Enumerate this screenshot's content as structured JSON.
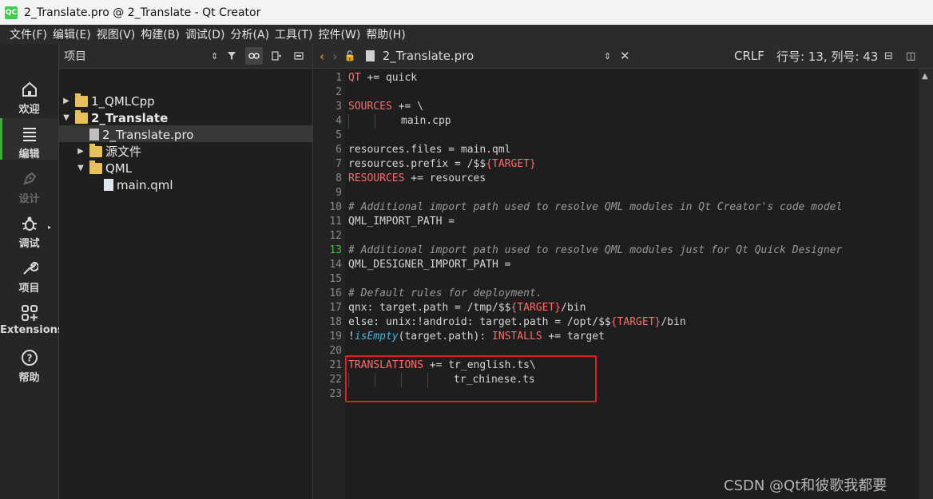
{
  "window": {
    "title": "2_Translate.pro @ 2_Translate - Qt Creator",
    "logo_text": "QC"
  },
  "menu": [
    "文件(F)",
    "编辑(E)",
    "视图(V)",
    "构建(B)",
    "调试(D)",
    "分析(A)",
    "工具(T)",
    "控件(W)",
    "帮助(H)"
  ],
  "modes": [
    {
      "label": "欢迎",
      "icon": "home-icon"
    },
    {
      "label": "编辑",
      "icon": "edit-lines-icon"
    },
    {
      "label": "设计",
      "icon": "pen-icon"
    },
    {
      "label": "调试",
      "icon": "bug-icon"
    },
    {
      "label": "项目",
      "icon": "wrench-icon"
    },
    {
      "label": "Extensions",
      "icon": "extensions-icon"
    },
    {
      "label": "帮助",
      "icon": "help-icon"
    }
  ],
  "project_pane": {
    "title": "项目",
    "tree": [
      {
        "label": "1_QMLCpp"
      },
      {
        "label": "2_Translate"
      },
      {
        "label": "2_Translate.pro"
      },
      {
        "label": "源文件"
      },
      {
        "label": "QML"
      },
      {
        "label": "main.qml"
      }
    ]
  },
  "editor": {
    "file_name": "2_Translate.pro",
    "line_ending": "CRLF",
    "cursor_position": "行号: 13, 列号: 43",
    "current_line": 13,
    "line_numbers": [
      "1",
      "2",
      "3",
      "4",
      "5",
      "6",
      "7",
      "8",
      "9",
      "10",
      "11",
      "12",
      "13",
      "14",
      "15",
      "16",
      "17",
      "18",
      "19",
      "20",
      "21",
      "22",
      "23"
    ],
    "lines": {
      "l1a": "QT",
      "l1b": " += quick",
      "l3a": "SOURCES",
      "l3b": " += \\",
      "l4": "main.cpp",
      "l6": "resources.files = main.qml",
      "l7a": "resources.prefix = /$$",
      "l7b": "{TARGET}",
      "l8a": "RESOURCES",
      "l8b": " += resources",
      "l10": "# Additional import path used to resolve QML modules in Qt Creator's code model",
      "l11": "QML_IMPORT_PATH =",
      "l13": "# Additional import path used to resolve QML modules just for Qt Quick Designer",
      "l14": "QML_DESIGNER_IMPORT_PATH =",
      "l16": "# Default rules for deployment.",
      "l17a": "qnx: target.path = /tmp/$$",
      "l17b": "{TARGET}",
      "l17c": "/bin",
      "l18a": "else: unix:!android: target.path = /opt/$$",
      "l18b": "{TARGET}",
      "l18c": "/bin",
      "l19a": "!",
      "l19b": "isEmpty",
      "l19c": "(target.path): ",
      "l19d": "INSTALLS",
      "l19e": " += target",
      "l21a": "TRANSLATIONS",
      "l21b": " += tr_english.ts\\",
      "l22": "tr_chinese.ts"
    }
  },
  "watermark": "CSDN @Qt和彼歌我都要"
}
